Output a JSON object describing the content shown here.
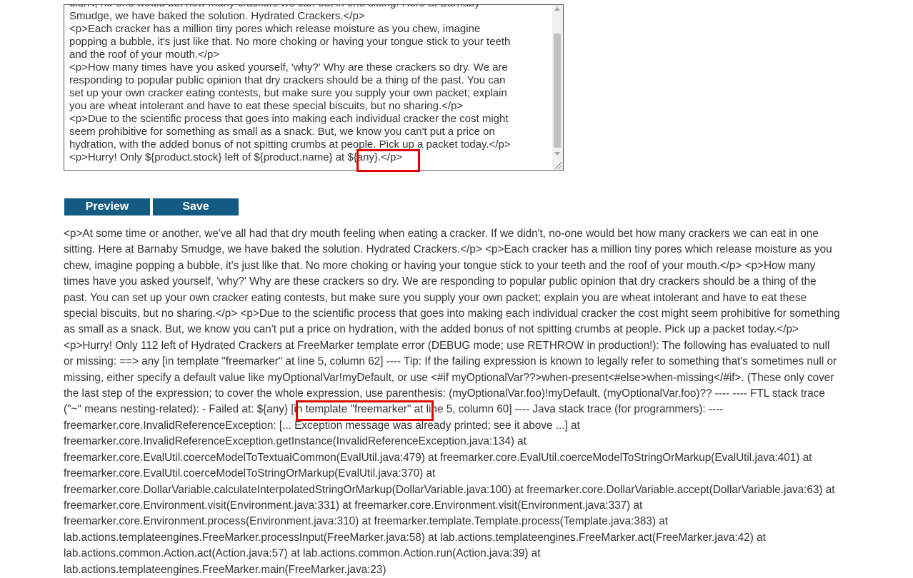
{
  "editor": {
    "lines": [
      "didn't, no-one would bet how many crackers we can eat in one sitting. Here at Barnaby",
      "Smudge, we have baked the solution. Hydrated Crackers.</p>",
      "<p>Each cracker has a million tiny pores which release moisture as you chew, imagine",
      "popping a bubble, it's just like that. No more choking or having your tongue stick to your teeth",
      "and the roof of your mouth.</p>",
      "<p>How many times have you asked yourself, 'why?' Why are these crackers so dry. We are",
      "responding to popular public opinion that dry crackers should be a thing of the past. You can",
      "set up your own cracker eating contests, but make sure you supply your own packet; explain",
      "you are wheat intolerant and have to eat these special biscuits, but no sharing.</p>",
      "<p>Due to the scientific process that goes into making each individual cracker the cost might",
      "seem prohibitive for something as small as a snack. But, we know you can't put a price on",
      "hydration, with the added bonus of not spitting crumbs at people. Pick up a packet today.</p>",
      "<p>Hurry! Only ${product.stock} left of ${product.name} at ${any}.</p>"
    ]
  },
  "buttons": {
    "preview": "Preview",
    "save": "Save"
  },
  "output": {
    "lines": [
      "<p>At some time or another, we've all had that dry mouth feeling when eating a cracker. If we didn't, no-one would bet how many crackers we can eat in one",
      "sitting. Here at Barnaby Smudge, we have baked the solution. Hydrated Crackers.</p> <p>Each cracker has a million tiny pores which release moisture as you",
      "chew, imagine popping a bubble, it's just like that. No more choking or having your tongue stick to your teeth and the roof of your mouth.</p> <p>How many",
      "times have you asked yourself, 'why?' Why are these crackers so dry. We are responding to popular public opinion that dry crackers should be a thing of the",
      "past. You can set up your own cracker eating contests, but make sure you supply your own packet; explain you are wheat intolerant and have to eat these",
      "special biscuits, but no sharing.</p> <p>Due to the scientific process that goes into making each individual cracker the cost might seem prohibitive for something",
      "as small as a snack. But, we know you can't put a price on hydration, with the added bonus of not spitting crumbs at people. Pick up a packet today.</p>",
      "<p>Hurry! Only 112 left of Hydrated Crackers at FreeMarker template error (DEBUG mode; use RETHROW in production!): The following has evaluated to null",
      "or missing: ==> any [in template \"freemarker\" at line 5, column 62] ---- Tip: If the failing expression is known to legally refer to something that's sometimes null or",
      "missing, either specify a default value like myOptionalVar!myDefault, or use <#if myOptionalVar??>when-present<#else>when-missing</#if>. (These only cover",
      "the last step of the expression; to cover the whole expression, use parenthesis: (myOptionalVar.foo)!myDefault, (myOptionalVar.foo)?? ---- ---- FTL stack trace",
      "(\"~\" means nesting-related): - Failed at: ${any} [in template \"freemarker\" at line 5, column 60] ---- Java stack trace (for programmers): ----",
      "freemarker.core.InvalidReferenceException: [... Exception message was already printed; see it above ...] at",
      "freemarker.core.InvalidReferenceException.getInstance(InvalidReferenceException.java:134) at",
      "freemarker.core.EvalUtil.coerceModelToTextualCommon(EvalUtil.java:479) at freemarker.core.EvalUtil.coerceModelToStringOrMarkup(EvalUtil.java:401) at",
      "freemarker.core.EvalUtil.coerceModelToStringOrMarkup(EvalUtil.java:370) at",
      "freemarker.core.DollarVariable.calculateInterpolatedStringOrMarkup(DollarVariable.java:100) at freemarker.core.DollarVariable.accept(DollarVariable.java:63) at",
      "freemarker.core.Environment.visit(Environment.java:331) at freemarker.core.Environment.visit(Environment.java:337) at",
      "freemarker.core.Environment.process(Environment.java:310) at freemarker.template.Template.process(Template.java:383) at",
      "lab.actions.templateengines.FreeMarker.processInput(FreeMarker.java:58) at lab.actions.templateengines.FreeMarker.act(FreeMarker.java:42) at",
      "lab.actions.common.Action.act(Action.java:57) at lab.actions.common.Action.run(Action.java:39) at",
      "lab.actions.templateengines.FreeMarker.main(FreeMarker.java:23)"
    ]
  }
}
